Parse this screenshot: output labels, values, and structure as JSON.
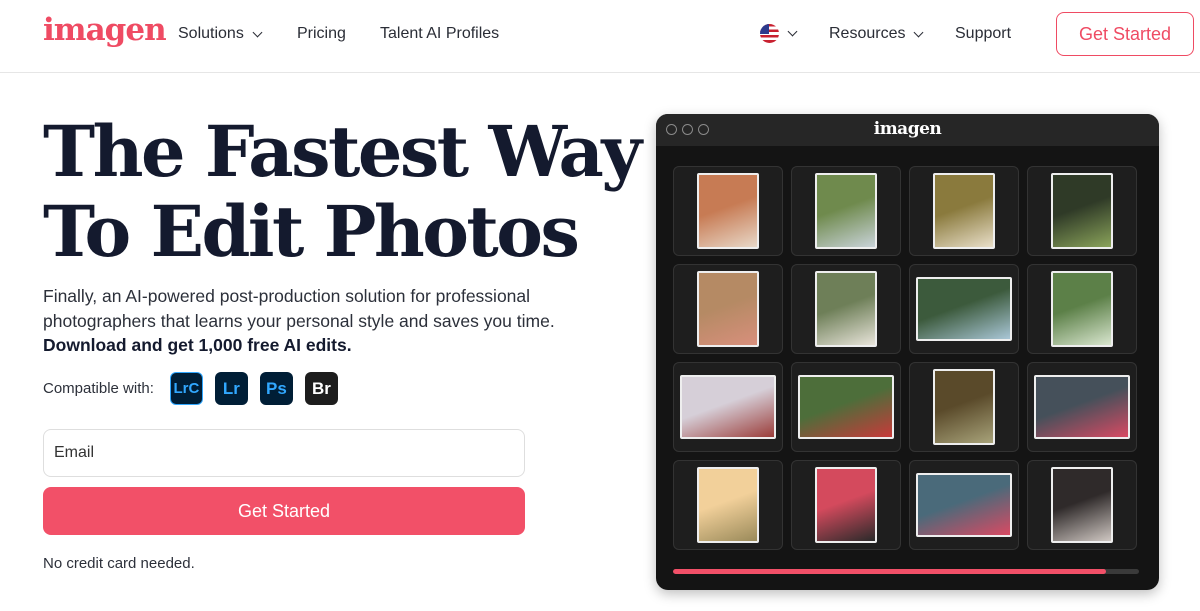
{
  "nav": {
    "logo": "imagen",
    "solutions": "Solutions",
    "pricing": "Pricing",
    "talent": "Talent AI Profiles",
    "resources": "Resources",
    "support": "Support",
    "cta": "Get Started"
  },
  "hero": {
    "title_line1": "The Fastest Way",
    "title_line2": "To Edit Photos",
    "desc": "Finally, an AI-powered post-production solution for professional photographers that learns your personal style and saves you time.",
    "desc_bold": "Download and get 1,000 free AI edits.",
    "compat_label": "Compatible with:",
    "apps": [
      "LrC",
      "Lr",
      "Ps",
      "Br"
    ],
    "email_placeholder": "Email",
    "cta": "Get Started",
    "note": "No credit card needed."
  },
  "app_window": {
    "logo": "imagen",
    "photos": [
      {
        "orientation": "portrait",
        "colors": [
          "#c77b54",
          "#e8d8c8"
        ]
      },
      {
        "orientation": "portrait",
        "colors": [
          "#6f8a4d",
          "#c9d3d9"
        ]
      },
      {
        "orientation": "portrait",
        "colors": [
          "#8a7a3d",
          "#e9dfc9"
        ]
      },
      {
        "orientation": "portrait",
        "colors": [
          "#2f3a27",
          "#8aa35a"
        ]
      },
      {
        "orientation": "portrait",
        "colors": [
          "#b58a64",
          "#d88f7c"
        ]
      },
      {
        "orientation": "portrait",
        "colors": [
          "#6e7f58",
          "#e8e4da"
        ]
      },
      {
        "orientation": "landscape",
        "colors": [
          "#3c5a3c",
          "#a9c6d6"
        ]
      },
      {
        "orientation": "portrait",
        "colors": [
          "#5c8048",
          "#d9e6cf"
        ]
      },
      {
        "orientation": "landscape",
        "colors": [
          "#d6cfd8",
          "#9b3d3a"
        ]
      },
      {
        "orientation": "landscape",
        "colors": [
          "#4d6e3a",
          "#c83a3a"
        ]
      },
      {
        "orientation": "portrait",
        "colors": [
          "#5a4a2a",
          "#a8a37a"
        ]
      },
      {
        "orientation": "landscape",
        "colors": [
          "#45505a",
          "#d84a63"
        ]
      },
      {
        "orientation": "portrait",
        "colors": [
          "#f2d09a",
          "#9a8a5a"
        ]
      },
      {
        "orientation": "portrait",
        "colors": [
          "#d44a5d",
          "#2a2a2a"
        ]
      },
      {
        "orientation": "landscape",
        "colors": [
          "#4a6a7a",
          "#d94a63"
        ]
      },
      {
        "orientation": "portrait",
        "colors": [
          "#2f2a2a",
          "#cfc7c2"
        ]
      }
    ],
    "progress": 0.93
  },
  "colors": {
    "accent": "#ef4b63",
    "heading": "#141a2e",
    "window_bg": "#141414"
  },
  "icons": [
    "chevron-down-icon",
    "us-flag-icon",
    "window-control-icon"
  ]
}
